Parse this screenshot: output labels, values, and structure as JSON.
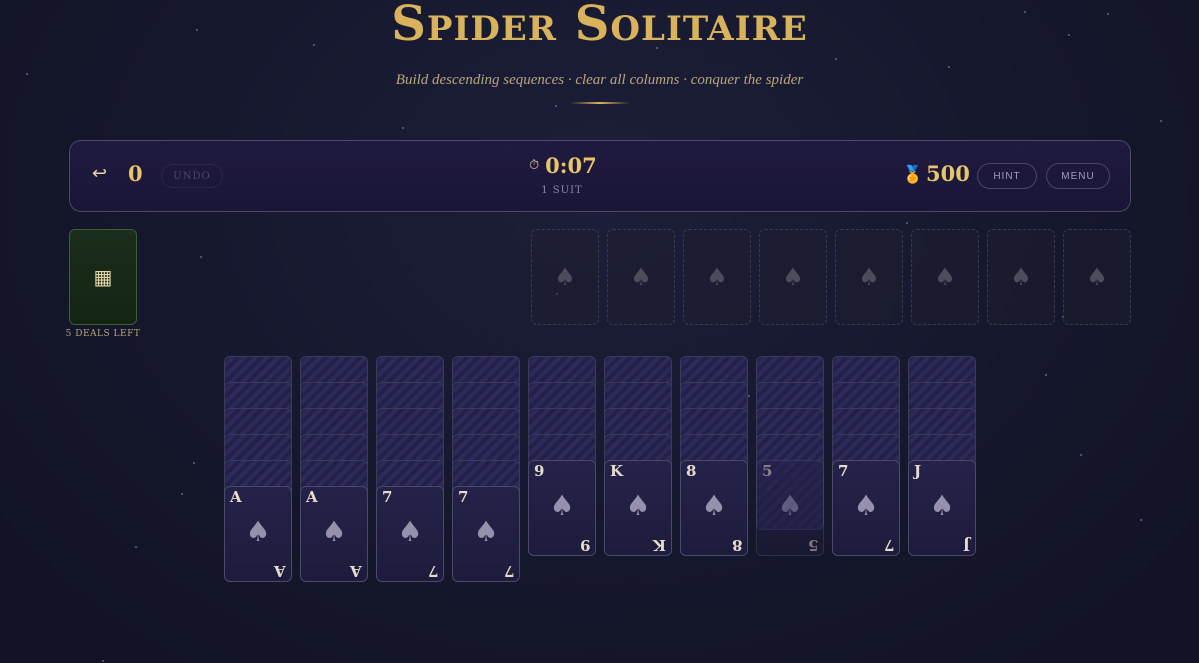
{
  "header": {
    "title": "Spider Solitaire",
    "subtitle": "Build descending sequences · clear all columns · conquer the spider"
  },
  "toolbar": {
    "moves_icon": "↩",
    "moves": "0",
    "undo_label": "UNDO",
    "timer_icon": "⏱",
    "timer": "0:07",
    "suits": "1 SUIT",
    "score_icon": "🏅",
    "score": "500",
    "hint_label": "HINT",
    "menu_label": "MENU"
  },
  "stock": {
    "icon": "▦",
    "deals_left": "5 DEALS LEFT"
  },
  "foundations": {
    "suit": "♠",
    "count": 8
  },
  "tableau": {
    "suit": "♠",
    "columns": [
      {
        "hidden": 5,
        "rank": "A",
        "dimmed": false
      },
      {
        "hidden": 5,
        "rank": "A",
        "dimmed": false
      },
      {
        "hidden": 5,
        "rank": "7",
        "dimmed": false
      },
      {
        "hidden": 5,
        "rank": "7",
        "dimmed": false
      },
      {
        "hidden": 4,
        "rank": "9",
        "dimmed": false
      },
      {
        "hidden": 4,
        "rank": "K",
        "dimmed": false
      },
      {
        "hidden": 4,
        "rank": "8",
        "dimmed": false
      },
      {
        "hidden": 4,
        "rank": "5",
        "dimmed": true
      },
      {
        "hidden": 4,
        "rank": "7",
        "dimmed": false
      },
      {
        "hidden": 4,
        "rank": "J",
        "dimmed": false
      }
    ]
  },
  "colors": {
    "accent_gold": "#d9b25c",
    "background": "#15172c",
    "stock_green": "#1b2e1a"
  }
}
